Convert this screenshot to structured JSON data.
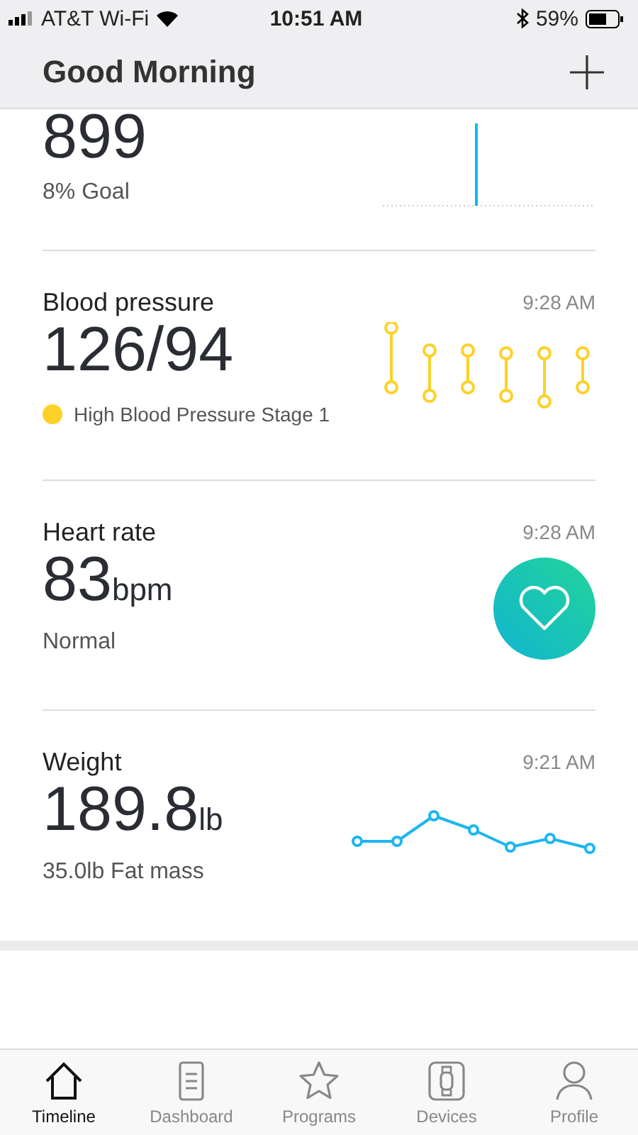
{
  "status_bar": {
    "carrier": "AT&T Wi-Fi",
    "time": "10:51 AM",
    "battery": "59%"
  },
  "header": {
    "title": "Good Morning"
  },
  "cards": [
    {
      "kind": "steps",
      "value": "899",
      "caption": "8% Goal"
    },
    {
      "kind": "blood_pressure",
      "title": "Blood pressure",
      "time": "9:28 AM",
      "value": "126/94",
      "status": "High Blood Pressure Stage 1",
      "color": "#fdd128"
    },
    {
      "kind": "heart_rate",
      "title": "Heart rate",
      "time": "9:28 AM",
      "value": "83",
      "unit": "bpm",
      "caption": "Normal"
    },
    {
      "kind": "weight",
      "title": "Weight",
      "time": "9:21 AM",
      "value": "189.8",
      "unit": "lb",
      "caption": "35.0lb Fat mass"
    }
  ],
  "tabs": [
    {
      "label": "Timeline",
      "selected": true
    },
    {
      "label": "Dashboard",
      "selected": false
    },
    {
      "label": "Programs",
      "selected": false
    },
    {
      "label": "Devices",
      "selected": false
    },
    {
      "label": "Profile",
      "selected": false
    }
  ]
}
